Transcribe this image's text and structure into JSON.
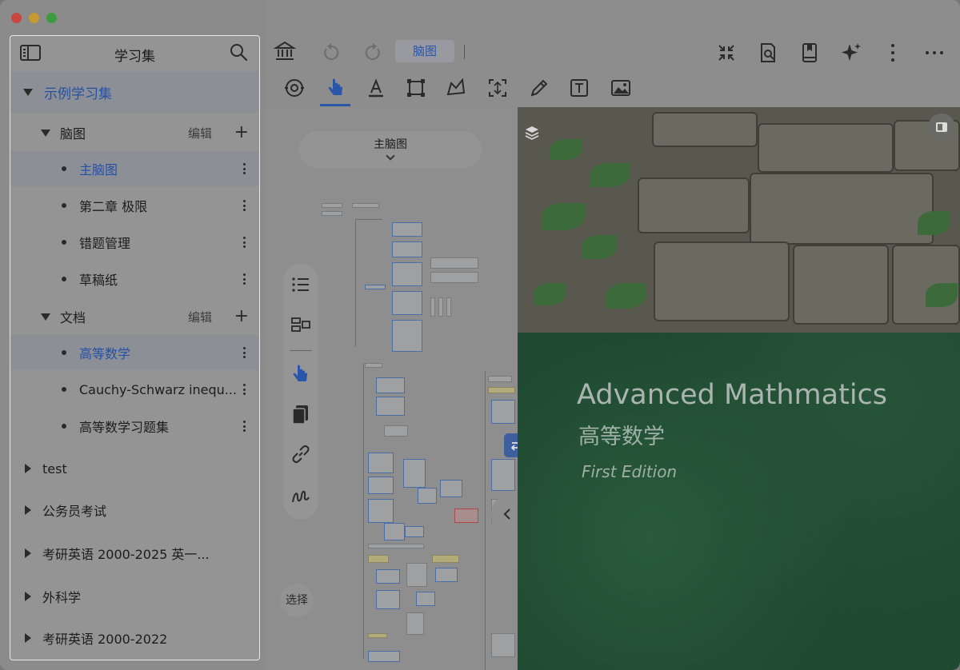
{
  "sidebar": {
    "title": "学习集",
    "root": {
      "label": "示例学习集"
    },
    "mindmaps": {
      "label": "脑图",
      "edit_label": "编辑",
      "items": [
        {
          "label": "主脑图"
        },
        {
          "label": "第二章 极限"
        },
        {
          "label": "错题管理"
        },
        {
          "label": "草稿纸"
        }
      ]
    },
    "documents": {
      "label": "文档",
      "edit_label": "编辑",
      "items": [
        {
          "label": "高等数学"
        },
        {
          "label": "Cauchy-Schwarz inequ..."
        },
        {
          "label": "高等数学习题集"
        }
      ]
    },
    "collections": [
      {
        "label": "test"
      },
      {
        "label": "公务员考试"
      },
      {
        "label": "考研英语 2000-2025 英一..."
      },
      {
        "label": "外科学"
      },
      {
        "label": "考研英语 2000-2022"
      }
    ]
  },
  "toolbar": {
    "active_tab": "脑图"
  },
  "mindmap": {
    "title": "主脑图",
    "select_label": "选择"
  },
  "document": {
    "title_en": "Advanced Mathmatics",
    "title_zh": "高等数学",
    "edition": "First Edition"
  },
  "colors": {
    "accent": "#2b55a8",
    "selected_text": "#2450a8",
    "cover_green": "#1f4a31"
  }
}
